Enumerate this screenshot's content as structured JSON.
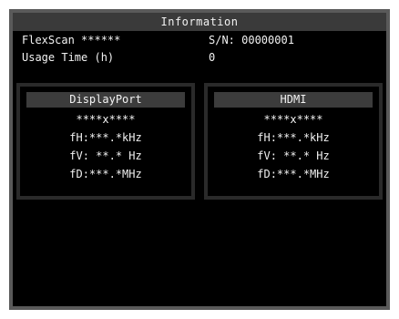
{
  "header": {
    "title": "Information"
  },
  "info": {
    "model_label": "FlexScan ******",
    "serial": "S/N: 00000001",
    "usage_label": "Usage Time (h)",
    "usage_value": "0"
  },
  "panels": [
    {
      "input": "DisplayPort",
      "resolution": "****x****",
      "fh": "fH:***.*kHz",
      "fv": "fV: **.* Hz",
      "fd": "fD:***.*MHz"
    },
    {
      "input": "HDMI",
      "resolution": "****x****",
      "fh": "fH:***.*kHz",
      "fv": "fV: **.* Hz",
      "fd": "fD:***.*MHz"
    }
  ],
  "colors": {
    "background": "#000000",
    "text": "#f2f2f2",
    "title_bar": "#3a3a3a",
    "frame": "#5a5a5a"
  }
}
